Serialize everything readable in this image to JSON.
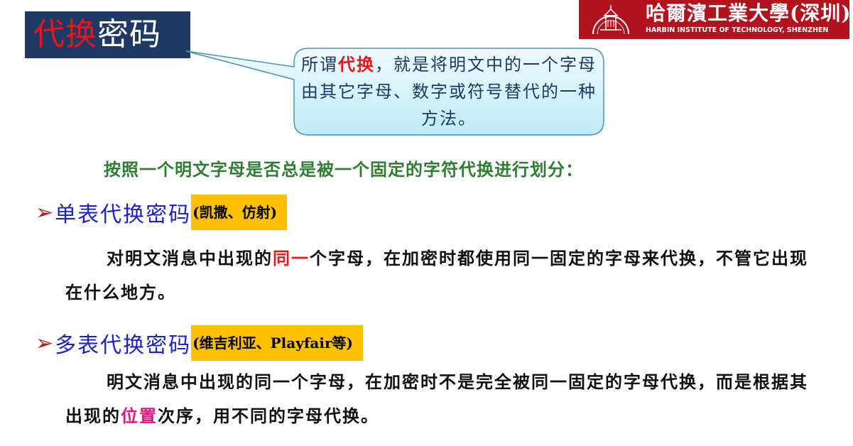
{
  "title": {
    "part_highlight": "代换",
    "part_rest": "密码"
  },
  "logo": {
    "name_cn": "哈爾濱工業大學(深圳)",
    "name_en": "HARBIN INSTITUTE OF TECHNOLOGY, SHENZHEN"
  },
  "callout": {
    "prefix": "所谓",
    "highlight": "代换",
    "suffix": "，就是将明文中的一个字母由其它字母、数字或符号替代的一种方法。"
  },
  "intro": "按照一个明文字母是否总是被一个固定的字符代换进行划分：",
  "sections": [
    {
      "arrow": "➢",
      "title": "单表代换密码",
      "note": "(凯撒、仿射)",
      "text_pre": "对明文消息中出现的",
      "text_highlight": "同一",
      "text_post": "个字母，在加密时都使用同一固定的字母来代换，不管它出现在什么地方。"
    },
    {
      "arrow": "➢",
      "title": "多表代换密码",
      "note": "(维吉利亚、Playfair等)",
      "text_pre": "明文消息中出现的同一个字母，在加密时不是完全被同一固定的字母代换，而是根据其出现的",
      "text_highlight": "位置",
      "text_post": "次序，用不同的字母代换。"
    }
  ],
  "colors": {
    "title_bg": "#1f3864",
    "logo_bg": "#b2111e",
    "highlight_red": "#e8161a",
    "note_bg": "#ffc000",
    "section_title": "#1a22c8",
    "intro_green": "#2e7d32",
    "callout_bg": "#d6f3fb"
  }
}
